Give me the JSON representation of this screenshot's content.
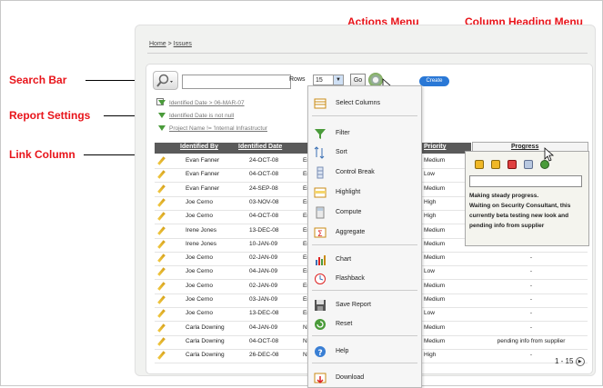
{
  "callouts": {
    "actions_menu": "Actions Menu",
    "column_heading_menu": "Column Heading Menu",
    "search_bar": "Search Bar",
    "report_settings": "Report Settings",
    "link_column": "Link Column"
  },
  "breadcrumb": {
    "home": "Home",
    "separator": " > ",
    "current": "Issues"
  },
  "search": {
    "value": "",
    "rows_label": "Rows",
    "rows_value": "15",
    "go_label": "Go",
    "create_label": "Create"
  },
  "report_settings": [
    "Identified Date > 06-MAR-07",
    "Identified Date is not null",
    "Project Name != 'Internal Infrastructur"
  ],
  "table": {
    "headers": {
      "identified_by": "Identified By",
      "identified_date": "Identified Date",
      "priority": "Priority",
      "progress": "Progress"
    },
    "rows": [
      {
        "by": "Evan Fanner",
        "date": "24-OCT-08",
        "col3": "Er",
        "priority": "Medium",
        "progress": ""
      },
      {
        "by": "Evan Fanner",
        "date": "04-OCT-08",
        "col3": "Er",
        "priority": "Low",
        "progress": ""
      },
      {
        "by": "Evan Fanner",
        "date": "24-SEP-08",
        "col3": "Er",
        "priority": "Medium",
        "progress": ""
      },
      {
        "by": "Joe Cerno",
        "date": "03-NOV-08",
        "col3": "Er",
        "priority": "High",
        "progress": ""
      },
      {
        "by": "Joe Cerno",
        "date": "04-OCT-08",
        "col3": "Er",
        "priority": "High",
        "progress": ""
      },
      {
        "by": "Irene Jones",
        "date": "13-DEC-08",
        "col3": "Er",
        "priority": "Medium",
        "progress": ""
      },
      {
        "by": "Irene Jones",
        "date": "10-JAN-09",
        "col3": "Er",
        "priority": "Medium",
        "progress": ""
      },
      {
        "by": "Joe Cerno",
        "date": "02-JAN-09",
        "col3": "Er",
        "priority": "Medium",
        "progress": "-"
      },
      {
        "by": "Joe Cerno",
        "date": "04-JAN-09",
        "col3": "Er",
        "priority": "Low",
        "progress": "-"
      },
      {
        "by": "Joe Cerno",
        "date": "02-JAN-09",
        "col3": "Er",
        "priority": "Medium",
        "progress": "-"
      },
      {
        "by": "Joe Cerno",
        "date": "03-JAN-09",
        "col3": "Er",
        "priority": "Medium",
        "progress": "-"
      },
      {
        "by": "Joe Cerno",
        "date": "13-DEC-08",
        "col3": "Er",
        "priority": "Low",
        "progress": "-"
      },
      {
        "by": "Carla Downing",
        "date": "04-JAN-09",
        "col3": "Nr",
        "priority": "Medium",
        "progress": "-"
      },
      {
        "by": "Carla Downing",
        "date": "04-OCT-08",
        "col3": "Nr",
        "priority": "Medium",
        "progress": "pending info from supplier"
      },
      {
        "by": "Carla Downing",
        "date": "26-DEC-08",
        "col3": "Nr",
        "priority": "High",
        "progress": "-"
      }
    ]
  },
  "actions_menu": [
    {
      "label": "Select Columns",
      "icon": "select-columns-icon"
    },
    {
      "label": "Filter",
      "icon": "filter-icon"
    },
    {
      "label": "Sort",
      "icon": "sort-icon"
    },
    {
      "label": "Control Break",
      "icon": "control-break-icon"
    },
    {
      "label": "Highlight",
      "icon": "highlight-icon"
    },
    {
      "label": "Compute",
      "icon": "compute-icon"
    },
    {
      "label": "Aggregate",
      "icon": "aggregate-icon"
    },
    {
      "label": "Chart",
      "icon": "chart-icon"
    },
    {
      "label": "Flashback",
      "icon": "flashback-icon"
    },
    {
      "label": "Save Report",
      "icon": "save-icon"
    },
    {
      "label": "Reset",
      "icon": "reset-icon"
    },
    {
      "label": "Help",
      "icon": "help-icon"
    },
    {
      "label": "Download",
      "icon": "download-icon"
    }
  ],
  "column_menu": {
    "search_value": "",
    "values": [
      "Making steady progress.",
      "Waiting on Security Consultant, this",
      "currently beta testing new look and",
      "pending info from supplier"
    ]
  },
  "pager": {
    "range": "1 - 15"
  },
  "colors": {
    "callout": "#e8141a",
    "header_bg": "#5a5a5a",
    "create_button": "#2a78d6",
    "funnel": "#4a9b3a"
  }
}
